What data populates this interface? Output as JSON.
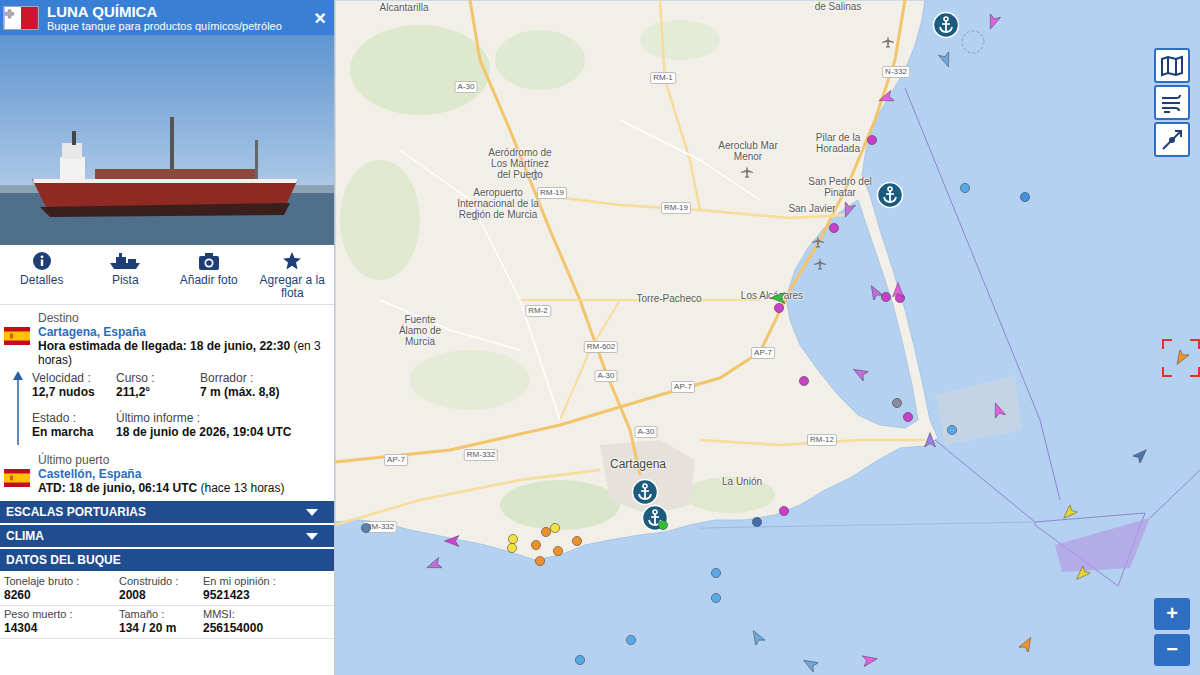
{
  "panel": {
    "title": "LUNA QUÍMICA",
    "subtitle": "Buque tanque para productos químicos/petróleo",
    "close": "×",
    "actions": [
      {
        "label": "Detalles"
      },
      {
        "label": "Pista"
      },
      {
        "label": "Añadir foto"
      },
      {
        "label": "Agregar a la flota"
      }
    ],
    "destination": {
      "label": "Destino",
      "port": "Cartagena, España",
      "eta": "Hora estimada de llegada: 18 de junio, 22:30",
      "eta_note": "(en 3 horas)"
    },
    "stats": [
      {
        "label": "Velocidad :",
        "value": "12,7 nudos"
      },
      {
        "label": "Curso :",
        "value": "211,2°"
      },
      {
        "label": "Borrador :",
        "value": "7 m (máx. 8,8)"
      },
      {
        "label": "Estado :",
        "value": "En marcha"
      },
      {
        "label": "Último informe :",
        "value": "18 de junio de 2026, 19:04 UTC"
      }
    ],
    "last_port": {
      "label": "Último puerto",
      "port": "Castellón, España",
      "atd": "ATD: 18 de junio, 06:14 UTC",
      "atd_note": "(hace 13 horas)"
    },
    "sections": [
      {
        "label": "ESCALAS PORTUARIAS",
        "expanded": false
      },
      {
        "label": "CLIMA",
        "expanded": false
      },
      {
        "label": "DATOS DEL BUQUE",
        "expanded": true
      }
    ],
    "ship_data": [
      {
        "label": "Tonelaje bruto :",
        "value": "8260"
      },
      {
        "label": "Construido :",
        "value": "2008"
      },
      {
        "label": "En mi opinión :",
        "value": "9521423"
      },
      {
        "label": "Peso muerto :",
        "value": "14304"
      },
      {
        "label": "Tamaño :",
        "value": "134 / 20 m"
      },
      {
        "label": "MMSI:",
        "value": "256154000"
      }
    ]
  },
  "map": {
    "places": [
      {
        "name": "Alcantarilla"
      },
      {
        "name": "de Salinas"
      },
      {
        "name": "Aeródromo de Los Martínez del Puerto"
      },
      {
        "name": "Aeropuerto Internacional de la Región de Murcia"
      },
      {
        "name": "Aeroclub Mar Menor"
      },
      {
        "name": "Pilar de la Horadada"
      },
      {
        "name": "San Pedro del Pinatar"
      },
      {
        "name": "San Javier"
      },
      {
        "name": "Torre-Pacheco"
      },
      {
        "name": "Los Alcázares"
      },
      {
        "name": "Fuente Álamo de Murcia"
      },
      {
        "name": "Cartagena"
      },
      {
        "name": "La Unión"
      }
    ],
    "roads": [
      "A-30",
      "RM-1",
      "N-332",
      "RM-19",
      "RM-19",
      "RM-2",
      "RM-602",
      "A-30",
      "AP-7",
      "AP-7",
      "A-30",
      "RM-12",
      "AP-7",
      "RM-332",
      "RM-332"
    ],
    "vessels": [
      {
        "kind": "arrow",
        "color": "#e35ee3",
        "selected": false
      },
      {
        "kind": "arrow",
        "color": "#6fa8dc",
        "selected": false
      },
      {
        "kind": "arrow",
        "color": "#e35ee3",
        "selected": false
      },
      {
        "kind": "dot",
        "color": "#c93fc9",
        "selected": false
      },
      {
        "kind": "arrow",
        "color": "#c06fe0",
        "selected": false
      },
      {
        "kind": "dot",
        "color": "#c93fc9",
        "selected": false
      },
      {
        "kind": "dot",
        "color": "#5aa9e6",
        "selected": false
      },
      {
        "kind": "dot",
        "color": "#3f8fe0",
        "selected": false
      },
      {
        "kind": "arrow",
        "color": "#2fbf3a",
        "selected": false
      },
      {
        "kind": "dot",
        "color": "#c93fc9",
        "selected": false
      },
      {
        "kind": "arrow",
        "color": "#c06fe0",
        "selected": false
      },
      {
        "kind": "dot",
        "color": "#c93fc9",
        "selected": false
      },
      {
        "kind": "dot",
        "color": "#c93fc9",
        "selected": false
      },
      {
        "kind": "arrow",
        "color": "#e35ee3",
        "selected": false
      },
      {
        "kind": "arrow",
        "color": "#c06fe0",
        "selected": false
      },
      {
        "kind": "dot",
        "color": "#c93fc9",
        "selected": false
      },
      {
        "kind": "dot",
        "color": "#8a8aa0",
        "selected": false
      },
      {
        "kind": "dot",
        "color": "#c93fc9",
        "selected": false
      },
      {
        "kind": "arrow",
        "color": "#e35ee3",
        "selected": false
      },
      {
        "kind": "dot",
        "color": "#5aa9e6",
        "selected": false
      },
      {
        "kind": "arrow",
        "color": "#9a7fe0",
        "selected": false
      },
      {
        "kind": "arrow",
        "color": "#4f74b8",
        "selected": false
      },
      {
        "kind": "arrow",
        "color": "#e8d62a",
        "selected": false
      },
      {
        "kind": "arrow",
        "color": "#e8d62a",
        "selected": false
      },
      {
        "kind": "arrow",
        "color": "#f0962a",
        "selected": true
      },
      {
        "kind": "dot",
        "color": "#c93fc9",
        "selected": false
      },
      {
        "kind": "dot",
        "color": "#3f6fb0",
        "selected": false
      },
      {
        "kind": "dot",
        "color": "#2fbf3a",
        "selected": false
      },
      {
        "kind": "dot",
        "color": "#f0e040",
        "selected": false
      },
      {
        "kind": "dot",
        "color": "#f0e040",
        "selected": false
      },
      {
        "kind": "dot",
        "color": "#f0e040",
        "selected": false
      },
      {
        "kind": "dot",
        "color": "#f0902a",
        "selected": false
      },
      {
        "kind": "dot",
        "color": "#f0902a",
        "selected": false
      },
      {
        "kind": "dot",
        "color": "#f0902a",
        "selected": false
      },
      {
        "kind": "dot",
        "color": "#f0902a",
        "selected": false
      },
      {
        "kind": "dot",
        "color": "#f0902a",
        "selected": false
      },
      {
        "kind": "arrow",
        "color": "#d63fd6",
        "selected": false
      },
      {
        "kind": "arrow",
        "color": "#c06fe0",
        "selected": false
      },
      {
        "kind": "dot",
        "color": "#5a7fb0",
        "selected": false
      },
      {
        "kind": "dot",
        "color": "#5aa9e6",
        "selected": false
      },
      {
        "kind": "dot",
        "color": "#5aa9e6",
        "selected": false
      },
      {
        "kind": "dot",
        "color": "#5aa9e6",
        "selected": false
      },
      {
        "kind": "dot",
        "color": "#5aa9e6",
        "selected": false
      },
      {
        "kind": "arrow",
        "color": "#6fa8dc",
        "selected": false
      },
      {
        "kind": "arrow",
        "color": "#6fa8dc",
        "selected": false
      },
      {
        "kind": "arrow",
        "color": "#e35ee3",
        "selected": false
      },
      {
        "kind": "arrow",
        "color": "#f0962a",
        "selected": false
      }
    ],
    "zoom": {
      "in": "+",
      "out": "−"
    }
  }
}
